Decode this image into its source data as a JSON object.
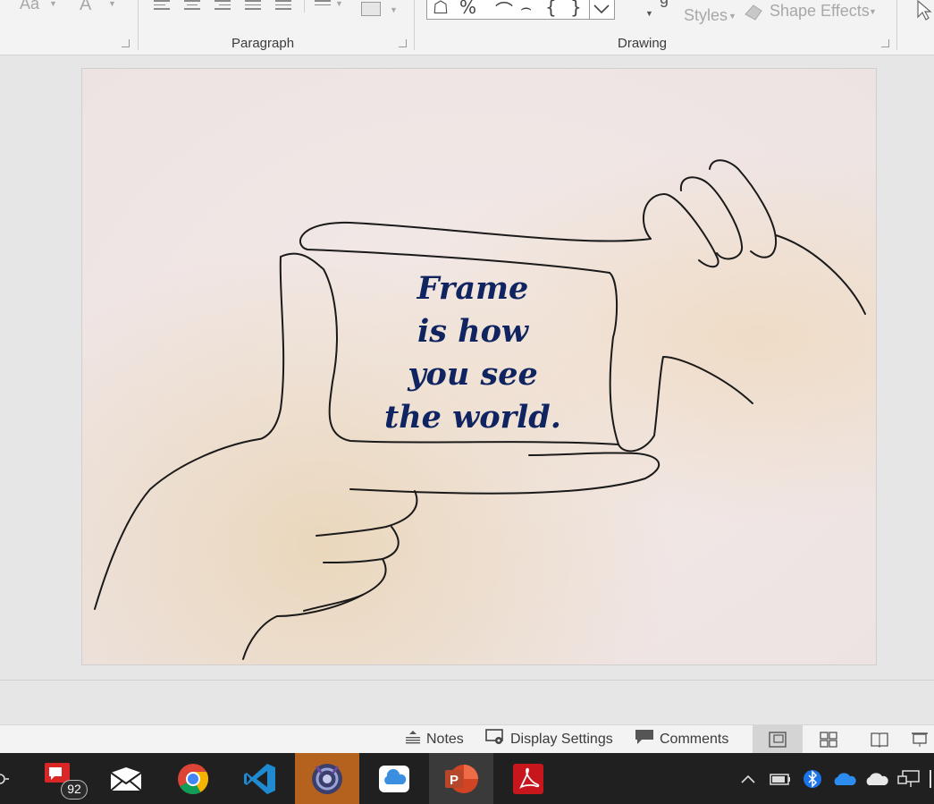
{
  "ribbon": {
    "font_row": {
      "change_case": "Aa",
      "font_color": "A"
    },
    "groups": {
      "paragraph": "Paragraph",
      "drawing": "Drawing"
    },
    "styles_label": "Styles",
    "shape_effects_label": "Shape Effects"
  },
  "slide": {
    "text_lines": [
      "Frame",
      "is how",
      "you see",
      "the world."
    ],
    "text_color": "#0f2460"
  },
  "statusbar": {
    "notes_label": "Notes",
    "display_settings_label": "Display Settings",
    "comments_label": "Comments"
  },
  "taskbar": {
    "apps": [
      "messaging-app-icon",
      "mail-icon",
      "chrome-icon",
      "vscode-icon",
      "media-app-icon",
      "icloud-icon",
      "powerpoint-icon",
      "acrobat-icon"
    ],
    "notification_badge": "92"
  },
  "colors": {
    "taskbar_bg": "#202020",
    "highlight_app": "#b5621f",
    "ribbon_bg": "#f3f3f3"
  }
}
